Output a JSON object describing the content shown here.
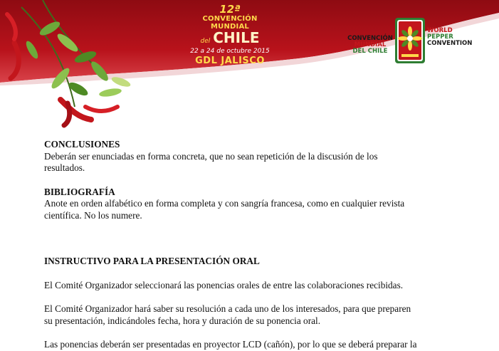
{
  "header": {
    "event": {
      "edition": "12ª",
      "title": "CONVENCIÓN MUNDIAL",
      "del": "del",
      "country": "CHILE",
      "dates": "22 a 24 de octubre 2015",
      "city": "GDL JALISCO"
    },
    "logo": {
      "left_line1": "CONVENCIÓN",
      "left_line2": "MUNDIAL",
      "left_line3": "DEL CHILE",
      "right_line1": "WORLD",
      "right_line2": "PEPPER",
      "right_line3": "CONVENTION"
    },
    "colors": {
      "banner_red": "#b8121b",
      "chili_red": "#c3161c",
      "leaf_green": "#4e8a24",
      "accent_gold": "#ffd84a"
    }
  },
  "document": {
    "conclusiones": {
      "heading": "CONCLUSIONES",
      "line1": "Deberán ser enunciadas en forma concreta, que no sean repetición de la discusión de los",
      "line2": "resultados."
    },
    "bibliografia": {
      "heading": "BIBLIOGRAFÍA",
      "line1": "Anote en orden alfabético en forma completa y con sangría francesa, como en cualquier revista",
      "line2": "científica. No los numere."
    },
    "instructivo": {
      "heading": "INSTRUCTIVO PARA LA PRESENTACIÓN ORAL",
      "para1": "El Comité Organizador seleccionará las ponencias orales de entre las colaboraciones recibidas.",
      "para2_line1": "El Comité Organizador hará saber su resolución a cada uno de los interesados, para que preparen",
      "para2_line2": "su presentación, indicándoles fecha, hora y duración de su ponencia oral.",
      "para3_line1": "Las ponencias deberán ser presentadas en proyector LCD (cañón), por lo que se deberá preparar la"
    }
  }
}
